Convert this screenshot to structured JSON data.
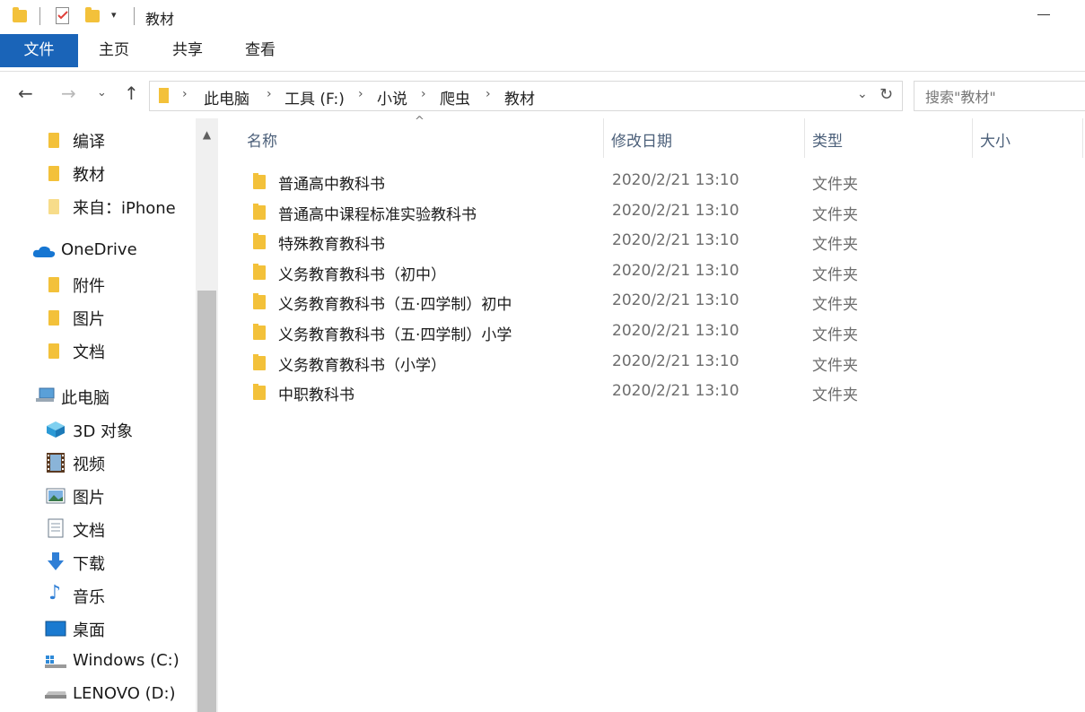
{
  "window": {
    "title": "教材"
  },
  "ribbon": {
    "tabs": [
      {
        "label": "文件"
      },
      {
        "label": "主页"
      },
      {
        "label": "共享"
      },
      {
        "label": "查看"
      }
    ]
  },
  "address": {
    "crumbs": [
      "此电脑",
      "工具 (F:)",
      "小说",
      "爬虫",
      "教材"
    ],
    "search_placeholder": "搜索\"教材\""
  },
  "sidebar": {
    "quick_access": [
      {
        "label": "编译"
      },
      {
        "label": "教材"
      },
      {
        "label": "来自：iPhone"
      }
    ],
    "onedrive": {
      "label": "OneDrive",
      "items": [
        {
          "label": "附件"
        },
        {
          "label": "图片"
        },
        {
          "label": "文档"
        }
      ]
    },
    "this_pc": {
      "label": "此电脑",
      "items": [
        {
          "label": "3D 对象"
        },
        {
          "label": "视频"
        },
        {
          "label": "图片"
        },
        {
          "label": "文档"
        },
        {
          "label": "下载"
        },
        {
          "label": "音乐"
        },
        {
          "label": "桌面"
        },
        {
          "label": "Windows (C:)"
        },
        {
          "label": "LENOVO (D:)"
        }
      ]
    }
  },
  "columns": {
    "name": "名称",
    "modified": "修改日期",
    "type": "类型",
    "size": "大小"
  },
  "files": [
    {
      "name": "普通高中教科书",
      "modified": "2020/2/21 13:10",
      "type": "文件夹"
    },
    {
      "name": "普通高中课程标准实验教科书",
      "modified": "2020/2/21 13:10",
      "type": "文件夹"
    },
    {
      "name": "特殊教育教科书",
      "modified": "2020/2/21 13:10",
      "type": "文件夹"
    },
    {
      "name": "义务教育教科书（初中）",
      "modified": "2020/2/21 13:10",
      "type": "文件夹"
    },
    {
      "name": "义务教育教科书（五·四学制）初中",
      "modified": "2020/2/21 13:10",
      "type": "文件夹"
    },
    {
      "name": "义务教育教科书（五·四学制）小学",
      "modified": "2020/2/21 13:10",
      "type": "文件夹"
    },
    {
      "name": "义务教育教科书（小学）",
      "modified": "2020/2/21 13:10",
      "type": "文件夹"
    },
    {
      "name": "中职教科书",
      "modified": "2020/2/21 13:10",
      "type": "文件夹"
    }
  ],
  "colors": {
    "accent": "#1a64b8",
    "folder": "#f3c13a",
    "header_text": "#4c607a"
  }
}
